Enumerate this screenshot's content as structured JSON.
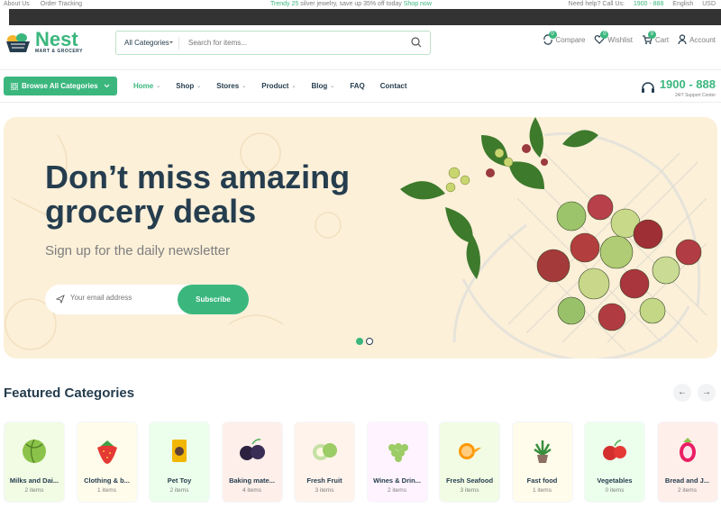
{
  "topbar": {
    "about": "About Us",
    "order": "Order Tracking",
    "promo_pre": "Trendy 25",
    "promo_mid": " silver jewelry, save up 35% off today ",
    "promo_link": "Shop now",
    "help": "Need help? Call Us: ",
    "phone": "1900 - 888",
    "lang": "English",
    "currency": "USD"
  },
  "logo": {
    "name": "Nest",
    "tagline": "MART & GROCERY"
  },
  "search": {
    "category": "All Categories",
    "placeholder": "Search for items..."
  },
  "actions": [
    {
      "label": "Compare",
      "count": "0"
    },
    {
      "label": "Wishlist",
      "count": "0"
    },
    {
      "label": "Cart",
      "count": "0"
    },
    {
      "label": "Account"
    }
  ],
  "nav": {
    "browse": "Browse  All Categories",
    "items": [
      "Home",
      "Shop",
      "Stores",
      "Product",
      "Blog",
      "FAQ",
      "Contact"
    ],
    "support_number": "1900 - 888",
    "support_label": "24/7 Support Center"
  },
  "hero": {
    "title": "Don’t miss amazing grocery deals",
    "subtitle": "Sign up for the daily newsletter",
    "email_placeholder": "Your email address",
    "subscribe": "Subscribe"
  },
  "featured": {
    "title": "Featured Categories",
    "categories": [
      {
        "name": "Milks and Dai...",
        "count": "2 items",
        "bg": "#f2fce4"
      },
      {
        "name": "Clothing & b...",
        "count": "1 items",
        "bg": "#fffceb"
      },
      {
        "name": "Pet Toy",
        "count": "2 items",
        "bg": "#ecffec"
      },
      {
        "name": "Baking mate...",
        "count": "4 items",
        "bg": "#feefea"
      },
      {
        "name": "Fresh Fruit",
        "count": "3 items",
        "bg": "#fff3eb"
      },
      {
        "name": "Wines & Drin...",
        "count": "2 items",
        "bg": "#fff3ff"
      },
      {
        "name": "Fresh Seafood",
        "count": "3 items",
        "bg": "#f2fce4"
      },
      {
        "name": "Fast food",
        "count": "1 items",
        "bg": "#fffceb"
      },
      {
        "name": "Vegetables",
        "count": "0 items",
        "bg": "#ecffec"
      },
      {
        "name": "Bread and J...",
        "count": "2 items",
        "bg": "#feefea"
      }
    ]
  },
  "colors": {
    "brand": "#3bb77e",
    "heading": "#253d4e",
    "hero_bg": "#fcf0d9"
  }
}
